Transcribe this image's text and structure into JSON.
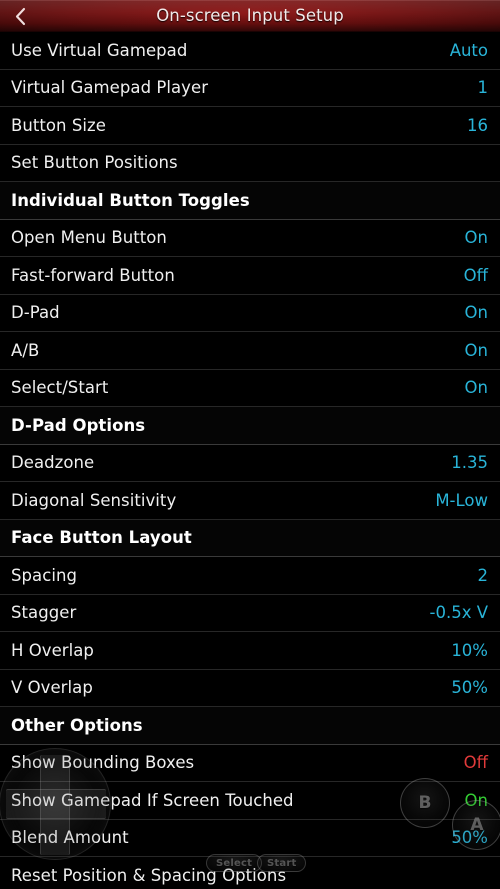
{
  "header": {
    "title": "On-screen Input Setup",
    "back_icon": "chevron-left-icon",
    "accent_red": "#6e1010"
  },
  "colors": {
    "value_default": "#29b4d8",
    "value_off": "#e03a3a",
    "value_on_green": "#33cc33",
    "label": "#f0f0f0",
    "background": "#000000"
  },
  "rows": [
    {
      "label": "Use Virtual Gamepad",
      "value": "Auto",
      "type": "item",
      "tone": "default"
    },
    {
      "label": "Virtual Gamepad Player",
      "value": "1",
      "type": "item",
      "tone": "default"
    },
    {
      "label": "Button Size",
      "value": "16",
      "type": "item",
      "tone": "default"
    },
    {
      "label": "Set Button Positions",
      "value": "",
      "type": "item",
      "tone": "default"
    },
    {
      "label": "Individual Button Toggles",
      "value": "",
      "type": "section",
      "tone": "default"
    },
    {
      "label": "Open Menu Button",
      "value": "On",
      "type": "item",
      "tone": "default"
    },
    {
      "label": "Fast-forward Button",
      "value": "Off",
      "type": "item",
      "tone": "default"
    },
    {
      "label": "D-Pad",
      "value": "On",
      "type": "item",
      "tone": "default"
    },
    {
      "label": "A/B",
      "value": "On",
      "type": "item",
      "tone": "default"
    },
    {
      "label": "Select/Start",
      "value": "On",
      "type": "item",
      "tone": "default"
    },
    {
      "label": "D-Pad Options",
      "value": "",
      "type": "section",
      "tone": "default"
    },
    {
      "label": "Deadzone",
      "value": "1.35",
      "type": "item",
      "tone": "default"
    },
    {
      "label": "Diagonal Sensitivity",
      "value": "M-Low",
      "type": "item",
      "tone": "default"
    },
    {
      "label": "Face Button Layout",
      "value": "",
      "type": "section",
      "tone": "default"
    },
    {
      "label": "Spacing",
      "value": "2",
      "type": "item",
      "tone": "default"
    },
    {
      "label": "Stagger",
      "value": "-0.5x V",
      "type": "item",
      "tone": "default"
    },
    {
      "label": "H Overlap",
      "value": "10%",
      "type": "item",
      "tone": "default"
    },
    {
      "label": "V Overlap",
      "value": "50%",
      "type": "item",
      "tone": "default"
    },
    {
      "label": "Other Options",
      "value": "",
      "type": "section",
      "tone": "default"
    },
    {
      "label": "Show Bounding Boxes",
      "value": "Off",
      "type": "item",
      "tone": "off"
    },
    {
      "label": "Show Gamepad If Screen Touched",
      "value": "On",
      "type": "item",
      "tone": "green"
    },
    {
      "label": "Blend Amount",
      "value": "50%",
      "type": "item",
      "tone": "default"
    },
    {
      "label": "Reset Position & Spacing Options",
      "value": "",
      "type": "item",
      "tone": "default"
    }
  ],
  "gamepad_overlay": {
    "dpad_name": "d-pad",
    "button_b": "B",
    "button_a": "A",
    "button_select": "Select",
    "button_start": "Start"
  }
}
